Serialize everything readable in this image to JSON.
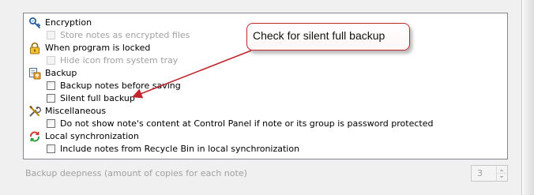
{
  "categories": [
    {
      "label": "Encryption",
      "icon": "key-icon",
      "options": [
        {
          "label": "Store notes as encrypted files",
          "checked": false,
          "enabled": false
        }
      ]
    },
    {
      "label": "When program is locked",
      "icon": "lock-icon",
      "options": [
        {
          "label": "Hide icon from system tray",
          "checked": false,
          "enabled": false
        }
      ]
    },
    {
      "label": "Backup",
      "icon": "backup-icon",
      "options": [
        {
          "label": "Backup notes before saving",
          "checked": false,
          "enabled": true
        },
        {
          "label": "Silent full backup",
          "checked": false,
          "enabled": true
        }
      ]
    },
    {
      "label": "Miscellaneous",
      "icon": "tools-icon",
      "options": [
        {
          "label": "Do not show note's content at Control Panel if note or its group is password protected",
          "checked": false,
          "enabled": true
        }
      ]
    },
    {
      "label": "Local synchronization",
      "icon": "sync-icon",
      "options": [
        {
          "label": "Include notes from Recycle Bin in local synchronization",
          "checked": false,
          "enabled": true
        }
      ]
    }
  ],
  "backup_depth": {
    "label": "Backup deepness (amount of copies for each note)",
    "value": "3",
    "enabled": false
  },
  "annotation": {
    "text": "Check for silent full backup",
    "color": "#c0262d"
  }
}
